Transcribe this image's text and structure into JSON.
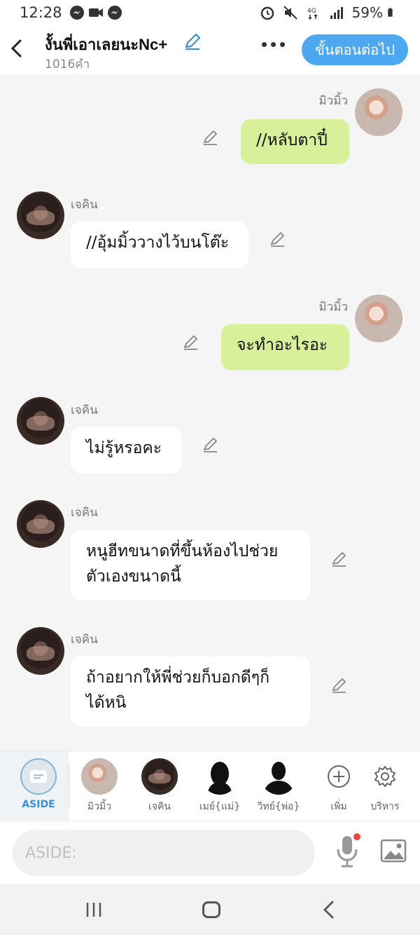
{
  "status": {
    "time": "12:28",
    "battery": "59%",
    "icons": [
      "messenger-icon",
      "video-icon",
      "messenger-icon",
      "alarm-icon",
      "mute-icon",
      "4g-icon",
      "signal-icon",
      "battery-icon"
    ]
  },
  "header": {
    "title": "งั้นพี่เอาเลยนะNc+",
    "word_count": "1016คำ",
    "next_label": "ขั้นตอนต่อไป"
  },
  "messages": [
    {
      "sender": "มิวมิ้ว",
      "side": "me",
      "lines": [
        "//หลับตาปี๋"
      ]
    },
    {
      "sender": "เจคิน",
      "side": "them",
      "lines": [
        "//อุ้มมิ้ววางไว้บนโต๊ะ"
      ]
    },
    {
      "sender": "มิวมิ้ว",
      "side": "me",
      "lines": [
        "จะทำอะไรอะ"
      ]
    },
    {
      "sender": "เจคิน",
      "side": "them",
      "lines": [
        "ไม่รู้หรอคะ"
      ]
    },
    {
      "sender": "เจคิน",
      "side": "them",
      "lines": [
        "หนูฮีทขนาดที่ขึ้นห้องไปช่วย",
        "ตัวเองขนาดนี้"
      ]
    },
    {
      "sender": "เจคิน",
      "side": "them",
      "lines": [
        "ถ้าอยากให้พี่ช่วยก็บอกดีๆก็",
        "ได้หนิ"
      ]
    }
  ],
  "characters": {
    "aside": "ASIDE",
    "mewmew": "มิวมิ้ว",
    "jakin": "เจคิน",
    "mom": "เมย์{แม่}",
    "dad": "วิทย์{พ่อ}",
    "add": "เพิ่ม",
    "manage": "บริหาร"
  },
  "input": {
    "placeholder": "ASIDE:"
  },
  "colors": {
    "accent": "#4da8f0",
    "my_bubble": "#d8f09a",
    "their_bubble": "#ffffff"
  }
}
